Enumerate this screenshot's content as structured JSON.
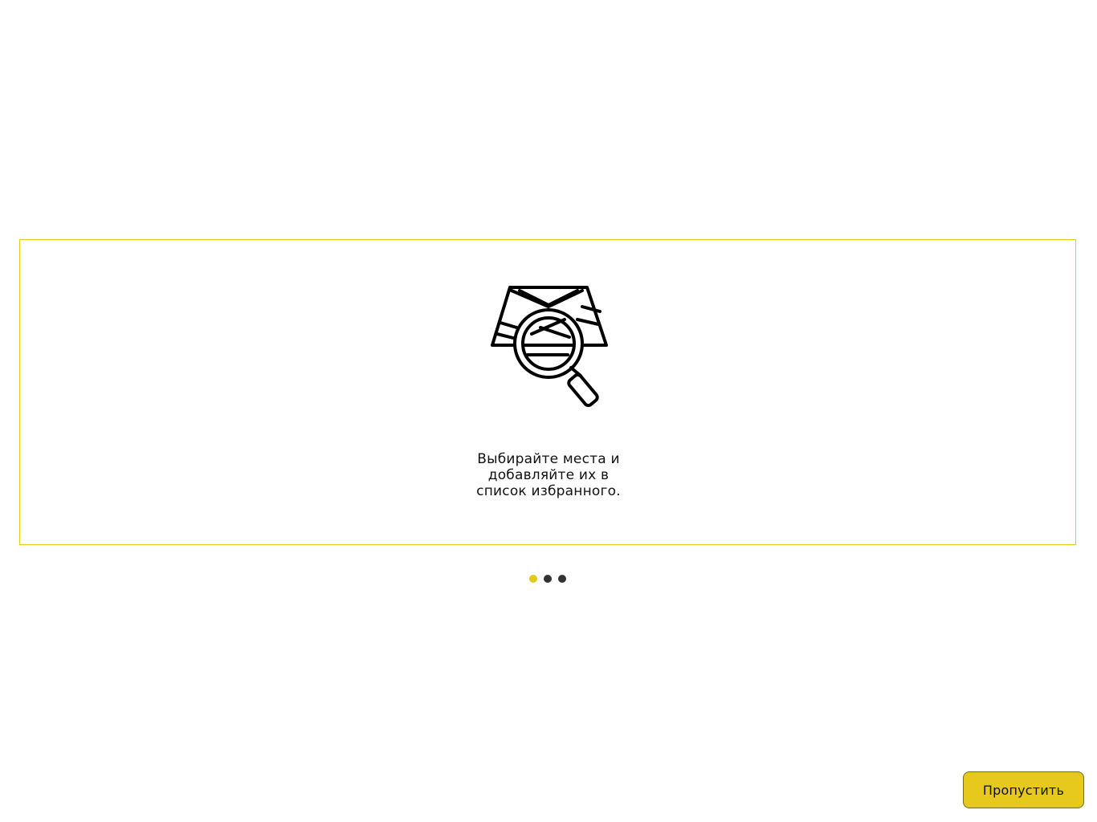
{
  "onboarding": {
    "illustration_icon": "map-search-icon",
    "slide_text": "Выбирайте места и\nдобавляйте их в\nсписок избранного.",
    "pagination": {
      "total": 3,
      "active_index": 0,
      "active_color": "#e3c918",
      "inactive_color": "#333333"
    }
  },
  "actions": {
    "skip_label": "Пропустить",
    "skip_color": "#e7c91d"
  },
  "theme": {
    "accent_border": "#e3cd1a"
  }
}
